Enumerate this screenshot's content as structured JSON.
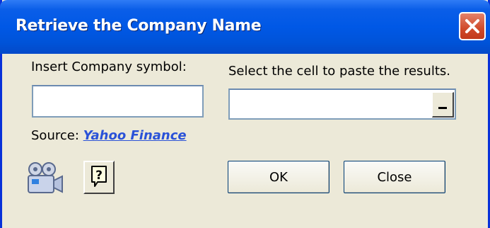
{
  "window": {
    "title": "Retrieve the Company Name",
    "close_icon": "close-x-icon"
  },
  "form": {
    "symbol_label": "Insert Company symbol:",
    "symbol_value": "",
    "cell_label": "Select the cell to paste the results.",
    "cell_value": "",
    "source_label": "Source:",
    "source_link": "Yahoo Finance"
  },
  "buttons": {
    "ok": "OK",
    "close": "Close",
    "help_icon": "help-icon",
    "video_icon": "video-camera-icon"
  },
  "colors": {
    "titlebar": "#0058e6",
    "dialog_bg": "#ece9d8",
    "link": "#2a52d8"
  }
}
